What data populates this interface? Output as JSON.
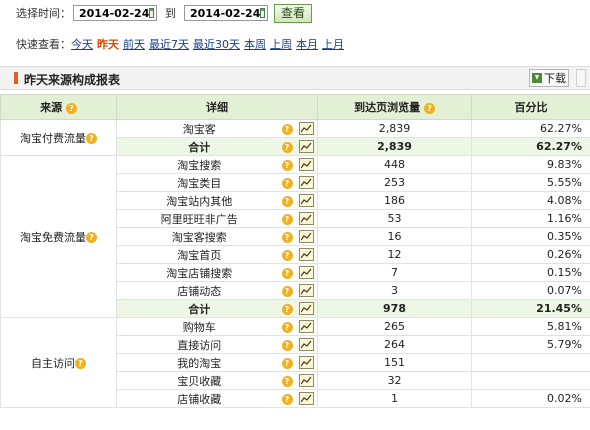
{
  "filter": {
    "label": "选择时间：",
    "start_date": "2014-02-24",
    "to_label": "到",
    "end_date": "2014-02-24",
    "view_button": "查看"
  },
  "quick": {
    "label": "快速查看：",
    "links": [
      {
        "label": "今天",
        "active": false
      },
      {
        "label": "昨天",
        "active": true
      },
      {
        "label": "前天",
        "active": false
      },
      {
        "label": "最近7天",
        "active": false
      },
      {
        "label": "最近30天",
        "active": false
      },
      {
        "label": "本周",
        "active": false
      },
      {
        "label": "上周",
        "active": false
      },
      {
        "label": "本月",
        "active": false
      },
      {
        "label": "上月",
        "active": false
      }
    ]
  },
  "report": {
    "title": "昨天来源构成报表",
    "download_label": "下载",
    "columns": [
      "来源",
      "详细",
      "到达页浏览量",
      "百分比"
    ]
  },
  "groups": [
    {
      "source": "淘宝付费流量",
      "rows": [
        {
          "name": "淘宝客",
          "views": "2,839",
          "pct": "62.27%"
        }
      ],
      "total": {
        "name": "合计",
        "views": "2,839",
        "pct": "62.27%"
      }
    },
    {
      "source": "淘宝免费流量",
      "rows": [
        {
          "name": "淘宝搜索",
          "views": "448",
          "pct": "9.83%"
        },
        {
          "name": "淘宝类目",
          "views": "253",
          "pct": "5.55%"
        },
        {
          "name": "淘宝站内其他",
          "views": "186",
          "pct": "4.08%"
        },
        {
          "name": "阿里旺旺非广告",
          "views": "53",
          "pct": "1.16%"
        },
        {
          "name": "淘宝客搜索",
          "views": "16",
          "pct": "0.35%"
        },
        {
          "name": "淘宝首页",
          "views": "12",
          "pct": "0.26%"
        },
        {
          "name": "淘宝店铺搜索",
          "views": "7",
          "pct": "0.15%"
        },
        {
          "name": "店铺动态",
          "views": "3",
          "pct": "0.07%"
        }
      ],
      "total": {
        "name": "合计",
        "views": "978",
        "pct": "21.45%"
      }
    },
    {
      "source": "自主访问",
      "rows": [
        {
          "name": "购物车",
          "views": "265",
          "pct": "5.81%"
        },
        {
          "name": "直接访问",
          "views": "264",
          "pct": "5.79%"
        },
        {
          "name": "我的淘宝",
          "views": "151",
          "pct": ""
        },
        {
          "name": "宝贝收藏",
          "views": "32",
          "pct": ""
        },
        {
          "name": "店铺收藏",
          "views": "1",
          "pct": "0.02%"
        }
      ],
      "total": null
    }
  ],
  "icons": {
    "help": "question-icon",
    "trend": "trend-chart-icon",
    "calendar": "calendar-icon",
    "download": "download-icon"
  },
  "colors": {
    "header_bg": "#e2f0d6",
    "total_row_bg": "#eef6e6",
    "active_link": "#d44a00",
    "link": "#1a3f8a",
    "title_mark": "#e06020"
  }
}
